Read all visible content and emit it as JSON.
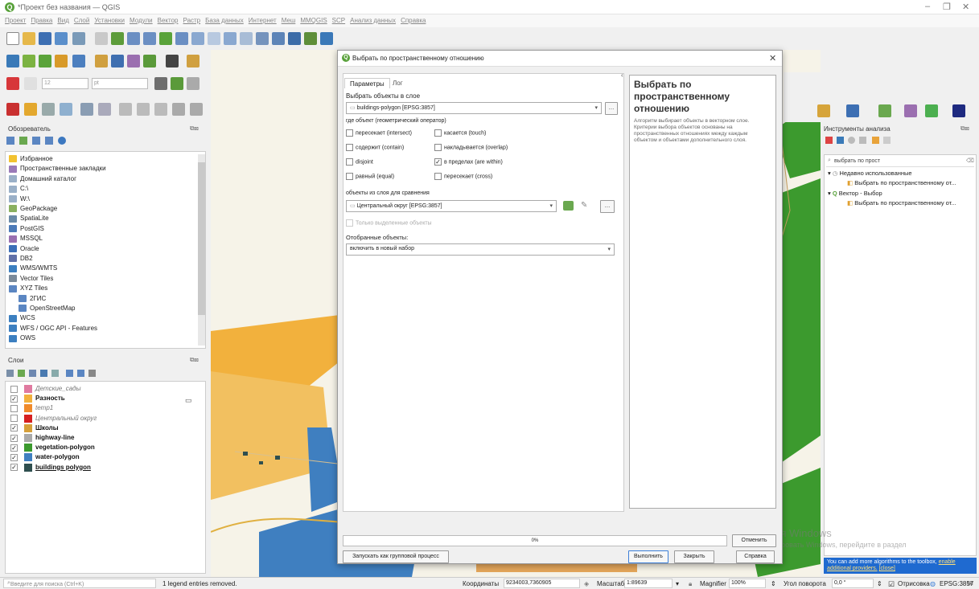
{
  "window": {
    "title": "*Проект без названия — QGIS"
  },
  "menu": [
    "Проект",
    "Правка",
    "Вид",
    "Слой",
    "Установки",
    "Модули",
    "Вектор",
    "Растр",
    "База данных",
    "Интернет",
    "Меш",
    "MMQGIS",
    "SCP",
    "Анализ данных",
    "Справка"
  ],
  "browser": {
    "header": "Обозреватель",
    "items": [
      "Избранное",
      "Пространственные закладки",
      "Домашний каталог",
      "C:\\",
      "W:\\",
      "GeoPackage",
      "SpatiaLite",
      "PostGIS",
      "MSSQL",
      "Oracle",
      "DB2",
      "WMS/WMTS",
      "Vector Tiles",
      "XYZ Tiles",
      "2ГИС",
      "OpenStreetMap",
      "WCS",
      "WFS / OGC API - Features",
      "OWS"
    ]
  },
  "layers": {
    "header": "Слои",
    "items": [
      {
        "name": "Детские_сады",
        "checked": false,
        "color": "#e07aa0"
      },
      {
        "name": "Разность",
        "checked": true,
        "color": "#f2b13d"
      },
      {
        "name": "temp1",
        "checked": false,
        "color": "#f08a2a"
      },
      {
        "name": "Центральный округ",
        "checked": false,
        "color": "#d62020"
      },
      {
        "name": "Школы",
        "checked": true,
        "color": "#d6a03a"
      },
      {
        "name": "highway-line",
        "checked": true,
        "color": "#aaaaaa"
      },
      {
        "name": "vegetation-polygon",
        "checked": true,
        "color": "#3c9a2e"
      },
      {
        "name": "water-polygon",
        "checked": true,
        "color": "#3f7fc0"
      },
      {
        "name": "buildings polygon",
        "checked": true,
        "color": "#2f4f4f"
      }
    ]
  },
  "dialog": {
    "title": "Выбрать по пространственному отношению",
    "tabs": [
      "Параметры",
      "Лог"
    ],
    "select_label": "Выбрать объекты в слое",
    "select_layer": "buildings-polygon [EPSG:3857]",
    "predicate_label": "где объект (геометрический оператор)",
    "predicates": [
      {
        "label": "пересекает (intersect)",
        "checked": false
      },
      {
        "label": "касается (touch)",
        "checked": false
      },
      {
        "label": "содержит (contain)",
        "checked": false
      },
      {
        "label": "накладывается (overlap)",
        "checked": false
      },
      {
        "label": "disjoint",
        "checked": false
      },
      {
        "label": "в пределах (are within)",
        "checked": true
      },
      {
        "label": "равный (equal)",
        "checked": false
      },
      {
        "label": "пересекает (cross)",
        "checked": false
      }
    ],
    "compare_label": "объекты из слоя для сравнения",
    "compare_layer": "Центральный округ [EPSG:3857]",
    "only_selected": "Только выделенные объекты",
    "modify_label": "Отобранные объекты:",
    "modify_value": "включить в новый набор",
    "progress": "0%",
    "cancel": "Отменить",
    "batch": "Запускать как групповой процесс",
    "run": "Выполнить",
    "close": "Закрыть",
    "help": "Справка",
    "help_title": "Выбрать по пространственному отношению",
    "help_text": "Алгоритм выбирает объекты в векторном слое. Критерии выбора объектов основаны на пространственных отношениях между каждым объектом и объектами дополнительного слоя."
  },
  "toolbox": {
    "header": "Инструменты анализа",
    "search": "выбрать по прост",
    "recent": "Недавно использованные",
    "recent_item": "Выбрать по пространственному от...",
    "group": "Вектор - Выбор",
    "group_item": "Выбрать по пространственному от...",
    "info": "You can add more algorithms to the toolbox,",
    "info_link": "enable additional providers.",
    "info_close": "[close]"
  },
  "watermark": {
    "line1": "Активация Windows",
    "line2": "Чтобы активировать Windows, перейдите в раздел"
  },
  "status": {
    "search_placeholder": "Введите для поиска (Ctrl+K)",
    "message": "1 legend entries removed.",
    "coord_label": "Координаты",
    "coord": "9234003,7360905",
    "scale_label": "Масштаб",
    "scale": "1:89639",
    "magnifier_label": "Magnifier",
    "magnifier": "100%",
    "rotation_label": "Угол поворота",
    "rotation": "0,0 °",
    "render": "Отрисовка",
    "crs": "EPSG:3857"
  }
}
